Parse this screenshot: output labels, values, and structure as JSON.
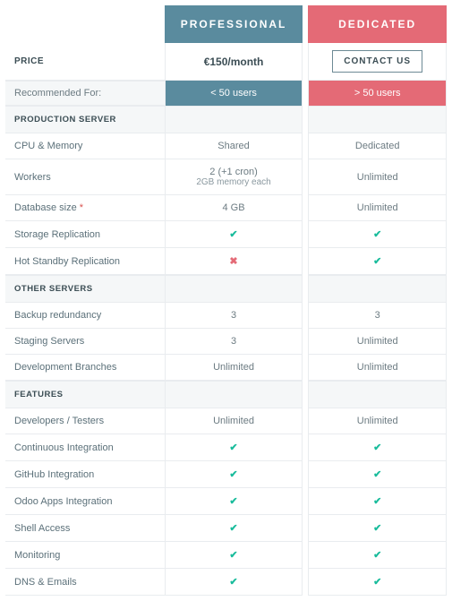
{
  "plans": {
    "professional": {
      "name": "PROFESSIONAL",
      "price": "€150/month",
      "recommended": "< 50 users"
    },
    "dedicated": {
      "name": "DEDICATED",
      "contact": "CONTACT US",
      "recommended": "> 50 users"
    }
  },
  "labels": {
    "price": "PRICE",
    "recommended_for": "Recommended For:",
    "sections": {
      "production_server": "PRODUCTION SERVER",
      "other_servers": "OTHER SERVERS",
      "features": "FEATURES"
    }
  },
  "rows": {
    "cpu_memory": {
      "label": "CPU & Memory",
      "pro": "Shared",
      "ded": "Dedicated"
    },
    "workers": {
      "label": "Workers",
      "pro": "2 (+1 cron)",
      "pro_sub": "2GB memory each",
      "ded": "Unlimited"
    },
    "db_size": {
      "label": "Database size",
      "asterisk": "*",
      "pro": "4 GB",
      "ded": "Unlimited"
    },
    "storage_replication": {
      "label": "Storage Replication",
      "pro": "check",
      "ded": "check"
    },
    "hot_standby": {
      "label": "Hot Standby Replication",
      "pro": "cross",
      "ded": "check"
    },
    "backup_redundancy": {
      "label": "Backup redundancy",
      "pro": "3",
      "ded": "3"
    },
    "staging_servers": {
      "label": "Staging Servers",
      "pro": "3",
      "ded": "Unlimited"
    },
    "dev_branches": {
      "label": "Development Branches",
      "pro": "Unlimited",
      "ded": "Unlimited"
    },
    "dev_testers": {
      "label": "Developers / Testers",
      "pro": "Unlimited",
      "ded": "Unlimited"
    },
    "ci": {
      "label": "Continuous Integration",
      "pro": "check",
      "ded": "check"
    },
    "github": {
      "label": "GitHub Integration",
      "pro": "check",
      "ded": "check"
    },
    "odoo_apps": {
      "label": "Odoo Apps Integration",
      "pro": "check",
      "ded": "check"
    },
    "shell": {
      "label": "Shell Access",
      "pro": "check",
      "ded": "check"
    },
    "monitoring": {
      "label": "Monitoring",
      "pro": "check",
      "ded": "check"
    },
    "dns_emails": {
      "label": "DNS & Emails",
      "pro": "check",
      "ded": "check"
    }
  },
  "icons": {
    "check": "✔",
    "cross": "✖"
  }
}
